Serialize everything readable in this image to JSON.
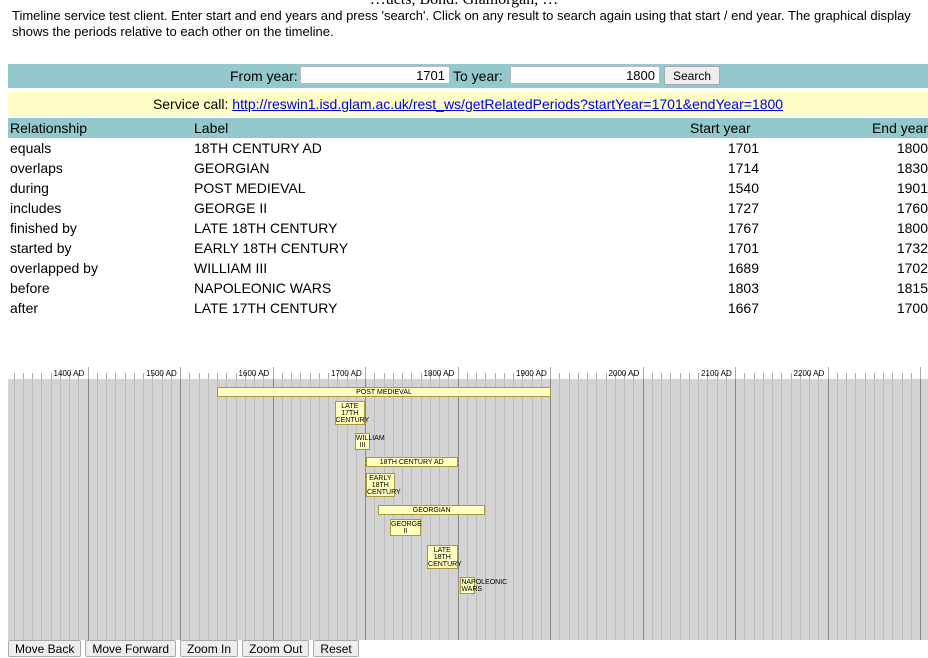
{
  "header": {
    "clipped_title": "…ucts, Bond: Glamorgan, …",
    "intro": "Timeline service test client. Enter start and end years and press 'search'. Click on any result to search again using that start / end year. The graphical display shows the periods relative to each other on the timeline."
  },
  "search": {
    "from_label": "From year:",
    "from_value": "1701",
    "to_label": "To year:",
    "to_value": "1800",
    "button_label": "Search"
  },
  "service": {
    "label": "Service call:",
    "url": "http://reswin1.isd.glam.ac.uk/rest_ws/getRelatedPeriods?startYear=1701&endYear=1800"
  },
  "table": {
    "headers": {
      "relationship": "Relationship",
      "label": "Label",
      "start": "Start year",
      "end": "End year"
    },
    "rows": [
      {
        "relationship": "equals",
        "label": "18TH CENTURY AD",
        "start": "1701",
        "end": "1800"
      },
      {
        "relationship": "overlaps",
        "label": "GEORGIAN",
        "start": "1714",
        "end": "1830"
      },
      {
        "relationship": "during",
        "label": "POST MEDIEVAL",
        "start": "1540",
        "end": "1901"
      },
      {
        "relationship": "includes",
        "label": "GEORGE II",
        "start": "1727",
        "end": "1760"
      },
      {
        "relationship": "finished by",
        "label": "LATE 18TH CENTURY",
        "start": "1767",
        "end": "1800"
      },
      {
        "relationship": "started by",
        "label": "EARLY 18TH CENTURY",
        "start": "1701",
        "end": "1732"
      },
      {
        "relationship": "overlapped by",
        "label": "WILLIAM III",
        "start": "1689",
        "end": "1702"
      },
      {
        "relationship": "before",
        "label": "NAPOLEONIC WARS",
        "start": "1803",
        "end": "1815"
      },
      {
        "relationship": "after",
        "label": "LATE 17TH CENTURY",
        "start": "1667",
        "end": "1700"
      }
    ]
  },
  "timeline": {
    "tick_labels": [
      "1400 AD",
      "1500 AD",
      "1600 AD",
      "1700 AD",
      "1800 AD",
      "1900 AD",
      "2000 AD",
      "2100 AD",
      "2200 AD"
    ],
    "periods": [
      {
        "label": "POST MEDIEVAL",
        "lines": [
          "POST MEDIEVAL"
        ],
        "start": 1540,
        "end": 1901
      },
      {
        "label": "LATE 17TH CENTURY",
        "lines": [
          "LATE",
          "17TH",
          "CENTURY"
        ],
        "start": 1667,
        "end": 1700
      },
      {
        "label": "WILLIAM III",
        "lines": [
          "WILLIAM",
          "III"
        ],
        "start": 1689,
        "end": 1702
      },
      {
        "label": "18TH CENTURY AD",
        "lines": [
          "18TH CENTURY AD"
        ],
        "start": 1701,
        "end": 1800
      },
      {
        "label": "EARLY 18TH CENTURY",
        "lines": [
          "EARLY",
          "18TH",
          "CENTURY"
        ],
        "start": 1701,
        "end": 1732
      },
      {
        "label": "GEORGIAN",
        "lines": [
          "GEORGIAN"
        ],
        "start": 1714,
        "end": 1830
      },
      {
        "label": "GEORGE II",
        "lines": [
          "GEORGE",
          "II"
        ],
        "start": 1727,
        "end": 1760
      },
      {
        "label": "LATE 18TH CENTURY",
        "lines": [
          "LATE",
          "18TH",
          "CENTURY"
        ],
        "start": 1767,
        "end": 1800
      },
      {
        "label": "NAPOLEONIC WARS",
        "lines": [
          "NAPOLEONIC",
          "WARS"
        ],
        "start": 1803,
        "end": 1815
      }
    ]
  },
  "controls": {
    "move_back": "Move Back",
    "move_forward": "Move Forward",
    "zoom_in": "Zoom In",
    "zoom_out": "Zoom Out",
    "reset": "Reset"
  }
}
